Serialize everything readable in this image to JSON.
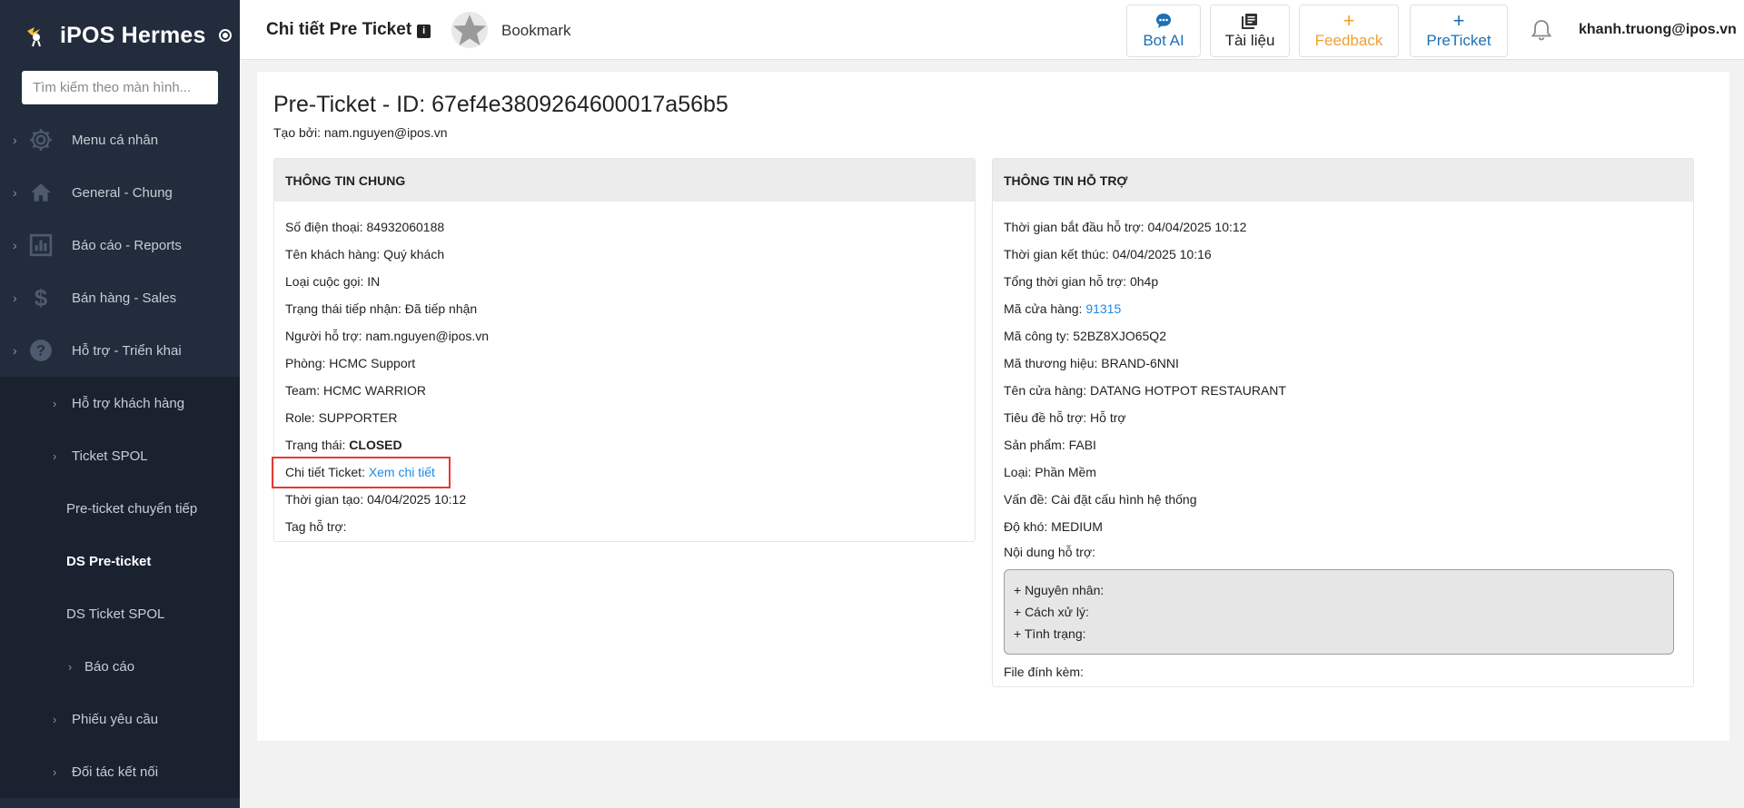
{
  "sidebar": {
    "brand": "iPOS Hermes",
    "search_placeholder": "Tìm kiếm theo màn hình...",
    "items": [
      {
        "label": "Menu cá nhân",
        "icon": "gear-icon"
      },
      {
        "label": "General - Chung",
        "icon": "home-icon"
      },
      {
        "label": "Báo cáo - Reports",
        "icon": "bar-chart-icon"
      },
      {
        "label": "Bán hàng - Sales",
        "icon": "dollar-icon"
      },
      {
        "label": "Hỗ trợ - Triển khai",
        "icon": "help-icon"
      }
    ],
    "subitems": [
      {
        "label": "Hỗ trợ khách hàng"
      },
      {
        "label": "Ticket SPOL"
      },
      {
        "label": "Pre-ticket chuyển tiếp"
      },
      {
        "label": "DS Pre-ticket"
      },
      {
        "label": "DS Ticket SPOL"
      },
      {
        "label": "Báo cáo"
      },
      {
        "label": "Phiếu yêu cầu"
      },
      {
        "label": "Đối tác kết nối"
      }
    ]
  },
  "topbar": {
    "title": "Chi tiết Pre Ticket",
    "bookmark": "Bookmark",
    "buttons": {
      "bot_ai": "Bot AI",
      "tai_lieu": "Tài liệu",
      "feedback": "Feedback",
      "preticket": "PreTicket"
    },
    "user_email": "khanh.truong@ipos.vn",
    "colors": {
      "bot_ai": "#1e6fb5",
      "feedback": "#f0a030",
      "preticket": "#1e6fb5"
    }
  },
  "main": {
    "heading": "Pre-Ticket - ID: 67ef4e3809264600017a56b5",
    "created_by": "Tạo bởi: nam.nguyen@ipos.vn",
    "general": {
      "title": "THÔNG TIN CHUNG",
      "phone": "Số điện thoại: 84932060188",
      "customer": "Tên khách hàng: Quý khách",
      "call_type": "Loại cuộc gọi: IN",
      "receive_status": "Trạng thái tiếp nhận: Đã tiếp nhận",
      "supporter": "Người hỗ trợ: nam.nguyen@ipos.vn",
      "room": "Phòng: HCMC Support",
      "team": "Team: HCMC WARRIOR",
      "role": "Role: SUPPORTER",
      "status_label": "Trạng thái: ",
      "status_value": "CLOSED",
      "ticket_detail_label": "Chi tiết Ticket: ",
      "ticket_detail_link": "Xem chi tiết",
      "created_time": "Thời gian tạo: 04/04/2025 10:12",
      "tags": "Tag hỗ trợ:"
    },
    "support": {
      "title": "THÔNG TIN HỖ TRỢ",
      "start": "Thời gian bắt đầu hỗ trợ: 04/04/2025 10:12",
      "end": "Thời gian kết thúc: 04/04/2025 10:16",
      "total": "Tổng thời gian hỗ trợ: 0h4p",
      "store_code_label": "Mã cửa hàng: ",
      "store_code": "91315",
      "company_code": "Mã công ty: 52BZ8XJO65Q2",
      "brand_code": "Mã thương hiệu: BRAND-6NNI",
      "store_name": "Tên cửa hàng: DATANG HOTPOT RESTAURANT",
      "support_title": "Tiêu đề hỗ trợ: Hỗ trợ",
      "product": "Sản phẩm: FABI",
      "type": "Loại: Phần Mềm",
      "issue": "Vấn đề: Cài đặt cấu hình hệ thống",
      "difficulty": "Độ khó: MEDIUM",
      "content_label": "Nội dung hỗ trợ:",
      "content_lines": [
        "+ Nguyên nhân:",
        "+ Cách xử lý:",
        "+ Tình trạng:"
      ],
      "attachments": "File đính kèm:"
    }
  }
}
